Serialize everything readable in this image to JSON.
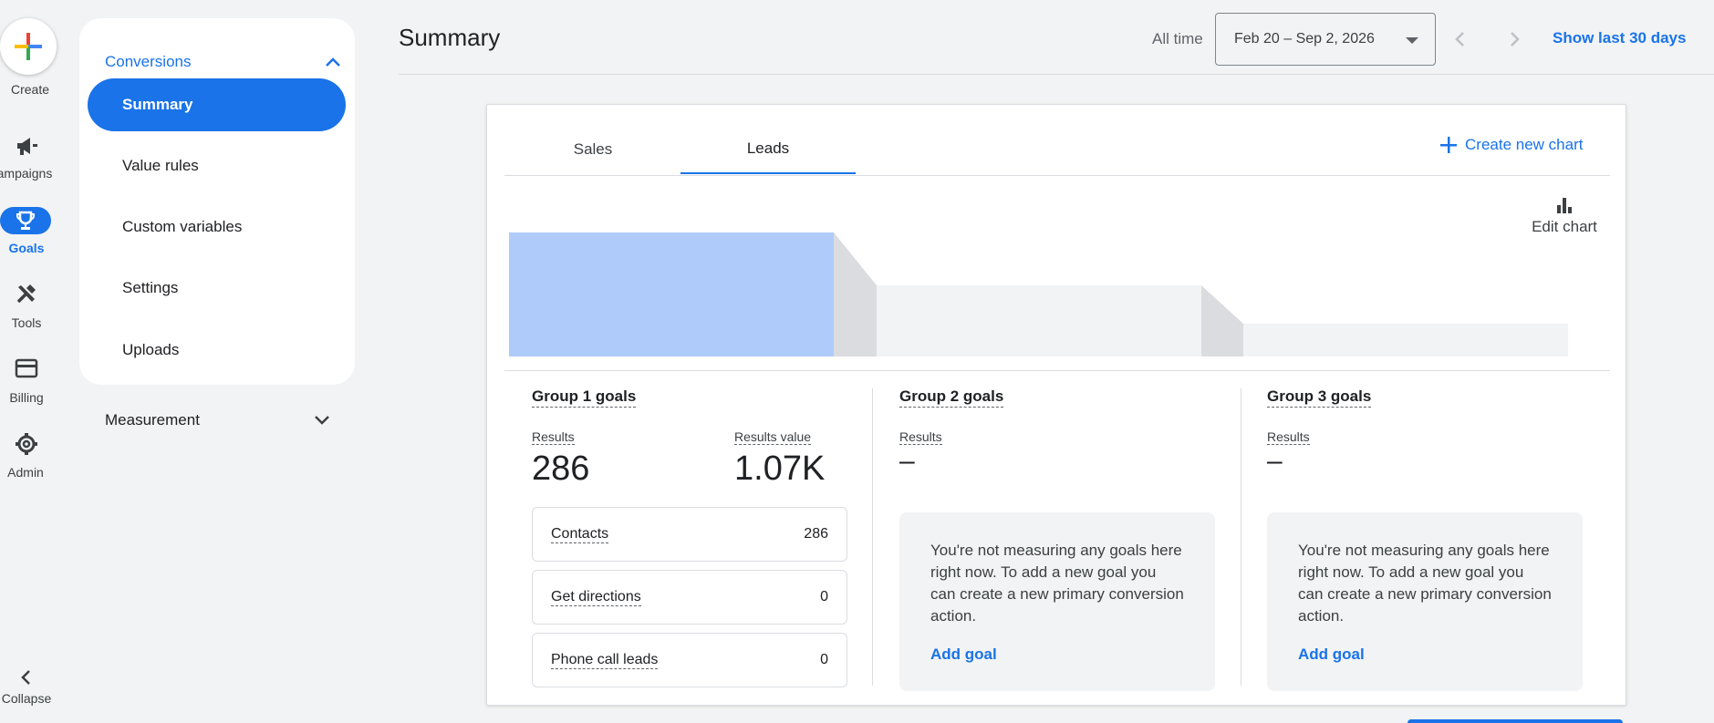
{
  "rail": {
    "create_label": "Create",
    "items": [
      {
        "label": "ampaigns",
        "icon": "megaphone-icon"
      },
      {
        "label": "Goals",
        "icon": "trophy-icon"
      },
      {
        "label": "Tools",
        "icon": "tools-icon"
      },
      {
        "label": "Billing",
        "icon": "credit-card-icon"
      },
      {
        "label": "Admin",
        "icon": "gear-icon"
      }
    ],
    "collapse_label": "Collapse"
  },
  "sidenav": {
    "section": "Conversions",
    "items": [
      {
        "label": "Summary"
      },
      {
        "label": "Value rules"
      },
      {
        "label": "Custom variables"
      },
      {
        "label": "Settings"
      },
      {
        "label": "Uploads"
      }
    ],
    "measurement": "Measurement"
  },
  "header": {
    "title": "Summary",
    "all_time": "All time",
    "date_range": "Feb 20 – Sep 2, 2026",
    "show_last": "Show last 30 days"
  },
  "card": {
    "tabs": [
      "Sales",
      "Leads"
    ],
    "create_chart": "Create new chart",
    "edit_chart": "Edit chart",
    "groups": [
      {
        "title": "Group 1 goals",
        "results_label": "Results",
        "results_value": "286",
        "value_label": "Results value",
        "value_value": "1.07K",
        "rows": [
          {
            "label": "Contacts",
            "value": "286"
          },
          {
            "label": "Get directions",
            "value": "0"
          },
          {
            "label": "Phone call leads",
            "value": "0"
          }
        ]
      },
      {
        "title": "Group 2 goals",
        "results_label": "Results",
        "results_value": "–",
        "empty_text": "You're not measuring any goals here right now. To add a new goal you can create a new primary conversion action.",
        "add_goal": "Add goal"
      },
      {
        "title": "Group 3 goals",
        "results_label": "Results",
        "results_value": "–",
        "empty_text": "You're not measuring any goals here right now. To add a new goal you can create a new primary conversion action.",
        "add_goal": "Add goal"
      }
    ]
  },
  "colors": {
    "accent": "#1a73e8",
    "funnel_active": "#aecbfa",
    "funnel_inactive": "#f1f3f4",
    "funnel_connector": "#dadce0"
  }
}
